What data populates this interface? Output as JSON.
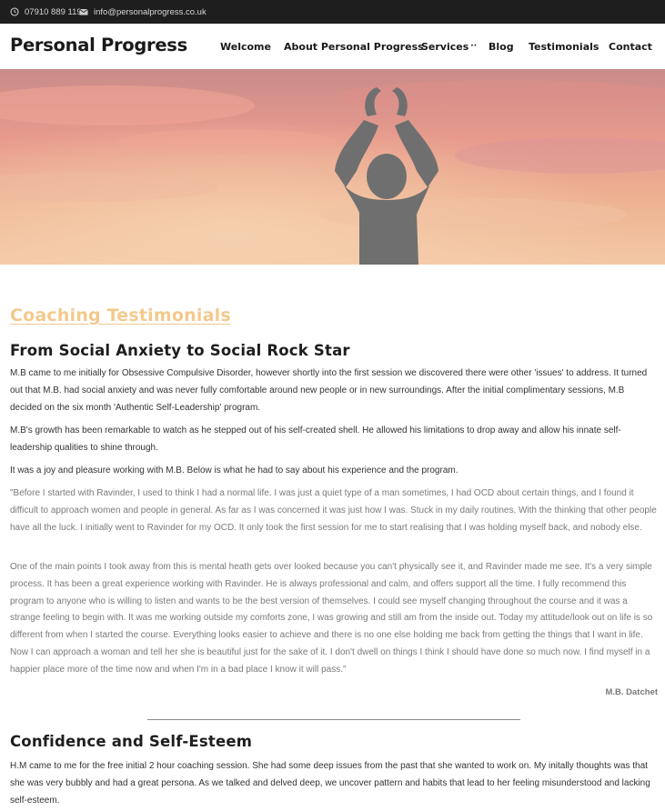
{
  "topbar": {
    "phone": "07910 889 119",
    "email": "info@personalprogress.co.uk"
  },
  "header": {
    "logo": "Personal Progress",
    "nav": [
      {
        "label": "Welcome"
      },
      {
        "label": "About Personal Progress"
      },
      {
        "label": "Services",
        "dropdown": "··"
      },
      {
        "label": "Blog"
      },
      {
        "label": "Testimonials"
      },
      {
        "label": "Contact"
      }
    ]
  },
  "hero": {
    "image": "silhouette-raised-arms-sunset"
  },
  "content": {
    "title": "Coaching Testimonials",
    "section1": {
      "heading": "From Social Anxiety to Social Rock Star",
      "p1": "M.B came to me initially for Obsessive Compulsive Disorder, however shortly into the first session we discovered there were other 'issues' to address. It turned out that M.B. had social anxiety and was never fully comfortable around new people or in new surroundings. After the initial complimentary sessions, M.B decided on the six month 'Authentic Self-Leadership' program.",
      "p2": "M.B's growth has been remarkable to watch as he stepped out of his self-created shell. He allowed his limitations to drop away and allow his innate self-leadership qualities to shine through.",
      "p3": "It was a joy and pleasure working with M.B. Below is what he had to say about his experience and the program.",
      "q1": "\"Before I started with Ravinder, I used to think I had a normal life. I was just a quiet type of a man sometimes, I had OCD about certain things, and I found it difficult to approach women and people in general. As far as I was concerned it was just how I was. Stuck in my daily routines. With the thinking that other people have all the luck. I initially went to Ravinder for my OCD. It only took the first session for me to start realising that I was holding myself back, and nobody else.",
      "q2": "One of the main points I took away from this is mental heath gets over looked because you can't physically see it, and Ravinder made me see. It's a very simple process. It has been a great experience working with Ravinder. He is always professional and calm, and offers support all the time. I fully recommend this program to anyone who is willing to listen and wants to be the best version of themselves. I could see myself changing throughout the course and it was a strange feeling to begin with. It was me working outside my comforts zone, I was growing and still am from the inside out. Today my attitude/look out on life is so different from when I started the course. Everything looks easier to achieve and there is no one else holding me back from getting the things that I want in life. Now I can approach a woman and tell her she is beautiful just for the sake of it. I don't dwell on things I think I should have done so much now. I find myself in a happier place more of the time now and when I'm in a bad place I know it will pass.\"",
      "signature": "M.B. Datchet"
    },
    "section2": {
      "heading": "Confidence and Self-Esteem",
      "p1": "H.M came to me for the free initial 2 hour coaching session. She had some deep issues from the past that she wanted to work on. My initally thoughts was that she was very bubbly and had a great persona. As we talked and delved deep, we uncover pattern and habits that lead to her feeling misunderstood and lacking self-esteem."
    }
  }
}
